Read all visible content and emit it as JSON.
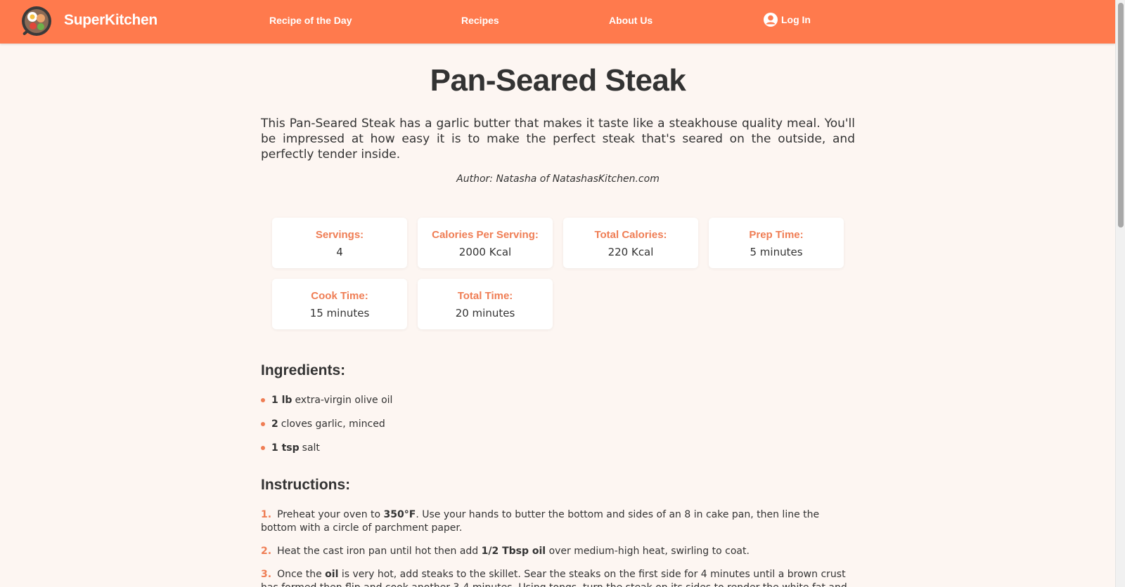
{
  "nav": {
    "brand": "SuperKitchen",
    "links": [
      "Recipe of the Day",
      "Recipes",
      "About Us"
    ],
    "login": "Log In"
  },
  "recipe": {
    "title": "Pan-Seared Steak",
    "description": "This Pan-Seared Steak has a garlic butter that makes it taste like a steakhouse quality meal. You'll be impressed at how easy it is to make the perfect steak that's seared on the outside, and perfectly tender inside.",
    "author": "Author: Natasha of NatashasKitchen.com"
  },
  "stats": [
    {
      "label": "Servings:",
      "value": "4"
    },
    {
      "label": "Calories Per Serving:",
      "value": "2000 Kcal"
    },
    {
      "label": "Total Calories:",
      "value": "220 Kcal"
    },
    {
      "label": "Prep Time:",
      "value": "5 minutes"
    },
    {
      "label": "Cook Time:",
      "value": "15 minutes"
    },
    {
      "label": "Total Time:",
      "value": "20 minutes"
    }
  ],
  "ingredients_heading": "Ingredients:",
  "ingredients": [
    {
      "qty": "1 lb",
      "name": "extra-virgin olive oil"
    },
    {
      "qty": "2",
      "name": "cloves garlic, minced"
    },
    {
      "qty": "1 tsp",
      "name": "salt"
    }
  ],
  "instructions_heading": "Instructions:",
  "instructions": [
    {
      "num": "1.",
      "pre": "Preheat your oven to ",
      "bold": "350°F",
      "post": ". Use your hands to butter the bottom and sides of an 8 in cake pan, then line the bottom with a circle of parchment paper."
    },
    {
      "num": "2.",
      "pre": "Heat the cast iron pan until hot then add ",
      "bold": "1/2 Tbsp oil",
      "post": " over medium-high heat, swirling to coat."
    },
    {
      "num": "3.",
      "pre": "Once the ",
      "bold": "oil",
      "post": " is very hot, add steaks to the skillet. Sear the steaks on the first side for 4 minutes until a brown crust has formed then flip and cook another 3-4 minutes. Using tongs, turn the steak on its sides to render the white fat and sear the"
    }
  ],
  "colors": {
    "accent": "#ff7a4d",
    "label": "#ef7d54",
    "background": "#fdf6f2"
  }
}
